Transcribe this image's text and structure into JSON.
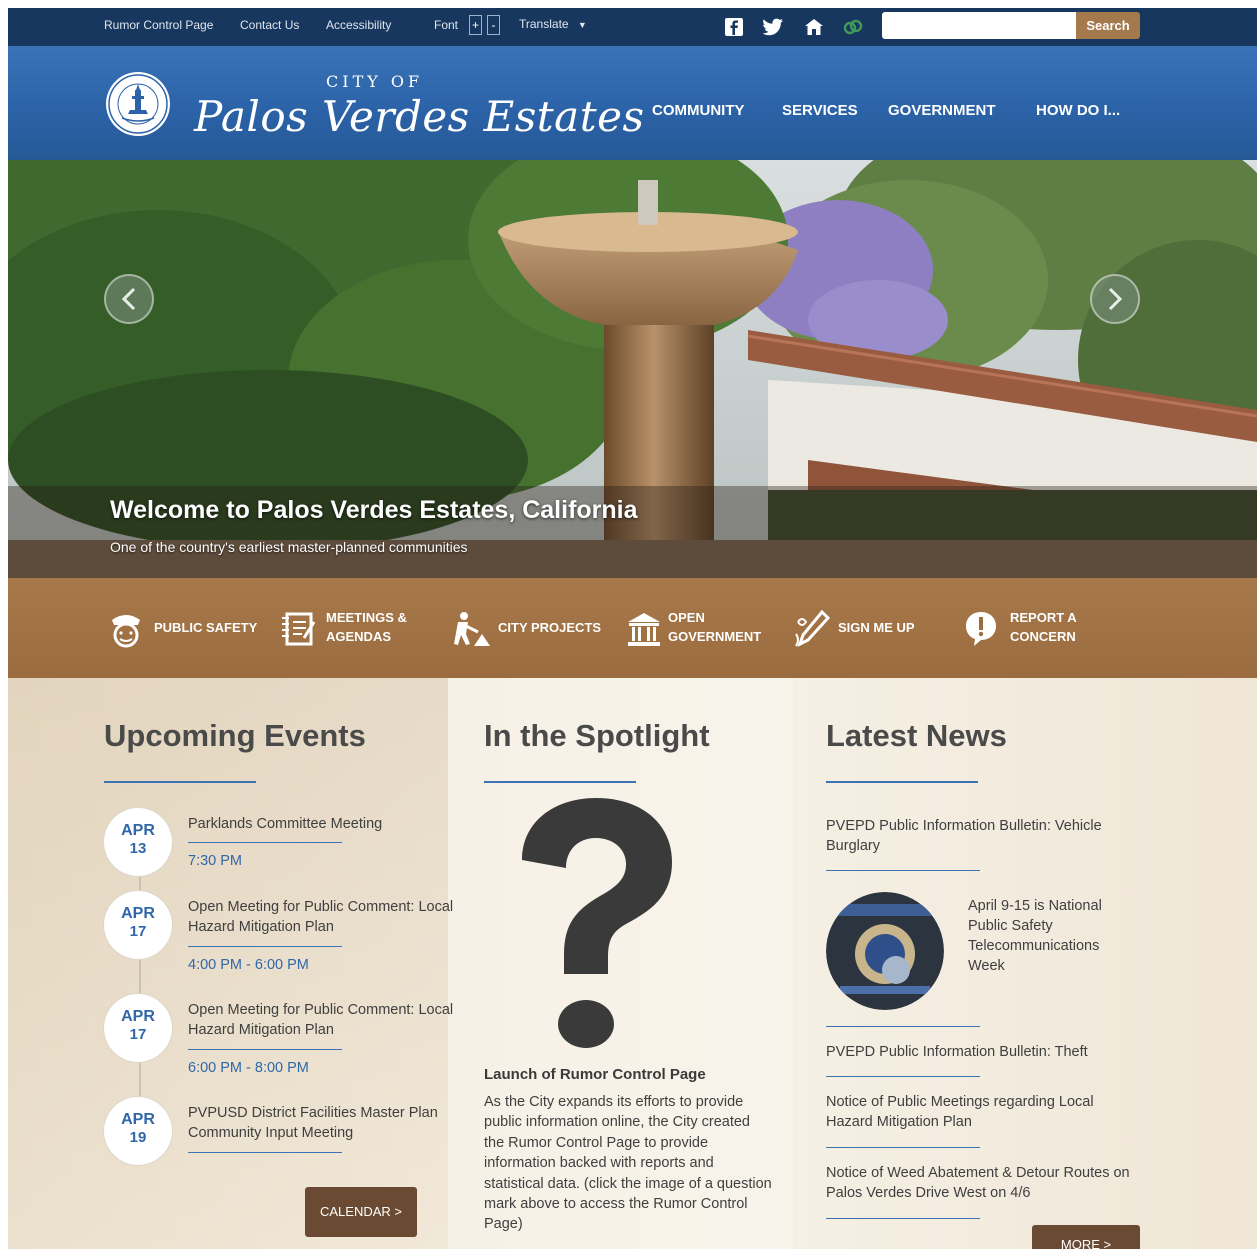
{
  "utility": {
    "links": [
      "Rumor Control Page",
      "Contact Us",
      "Accessibility"
    ],
    "font_label": "Font",
    "font_plus": "+",
    "font_minus": "-",
    "translate_label": "Translate",
    "social_icons": [
      "facebook-icon",
      "twitter-icon",
      "nextdoor-icon",
      "link-icon"
    ],
    "search_placeholder": "",
    "search_button": "Search"
  },
  "header": {
    "city_of": "CITY OF",
    "city_name": "Palos Verdes Estates",
    "nav": [
      "COMMUNITY",
      "SERVICES",
      "GOVERNMENT",
      "HOW DO I..."
    ]
  },
  "hero": {
    "title": "Welcome to Palos Verdes Estates, California",
    "subtitle": "One of the country's earliest master-planned communities"
  },
  "quick_links": [
    {
      "label": "PUBLIC SAFETY",
      "icon": "police-icon"
    },
    {
      "label": "MEETINGS &\nAGENDAS",
      "icon": "agenda-icon"
    },
    {
      "label": "CITY PROJECTS",
      "icon": "construction-icon"
    },
    {
      "label": "OPEN\nGOVERNMENT",
      "icon": "building-icon"
    },
    {
      "label": "SIGN ME UP",
      "icon": "pen-icon"
    },
    {
      "label": "REPORT A\nCONCERN",
      "icon": "alert-icon"
    }
  ],
  "events": {
    "title": "Upcoming Events",
    "items": [
      {
        "month": "APR",
        "day": "13",
        "title": "Parklands Committee Meeting",
        "time": "7:30 PM"
      },
      {
        "month": "APR",
        "day": "17",
        "title": "Open Meeting for Public Comment: Local Hazard Mitigation Plan",
        "time": "4:00 PM - 6:00 PM"
      },
      {
        "month": "APR",
        "day": "17",
        "title": "Open Meeting for Public Comment: Local Hazard Mitigation Plan",
        "time": "6:00 PM - 8:00 PM"
      },
      {
        "month": "APR",
        "day": "19",
        "title": "PVPUSD District Facilities Master Plan Community Input Meeting",
        "time": ""
      }
    ],
    "calendar_button": "CALENDAR >"
  },
  "spotlight": {
    "title": "In the Spotlight",
    "image_icon": "question-mark-icon",
    "headline": "Launch of Rumor Control Page",
    "body": "As the City expands its efforts to provide public information online, the City created the Rumor Control Page to provide information backed with reports and statistical data. (click the image of a question mark above to access the Rumor Control Page)"
  },
  "news": {
    "title": "Latest News",
    "items": [
      "PVEPD Public Information Bulletin: Vehicle Burglary",
      "April 9-15 is National Public Safety Telecommunications Week",
      "PVEPD Public Information Bulletin: Theft",
      "Notice of Public Meetings regarding Local Hazard Mitigation Plan",
      "Notice of Weed Abatement & Detour Routes on Palos Verdes Drive West on 4/6"
    ],
    "more_button": "MORE >"
  },
  "colors": {
    "utility_bar": "#17375e",
    "header_blue": "#2c63a8",
    "quickbar_brown": "#9b6c3f",
    "accent_blue": "#2f67a9",
    "button_brown": "#6b4a33",
    "search_button": "#a4794b"
  }
}
